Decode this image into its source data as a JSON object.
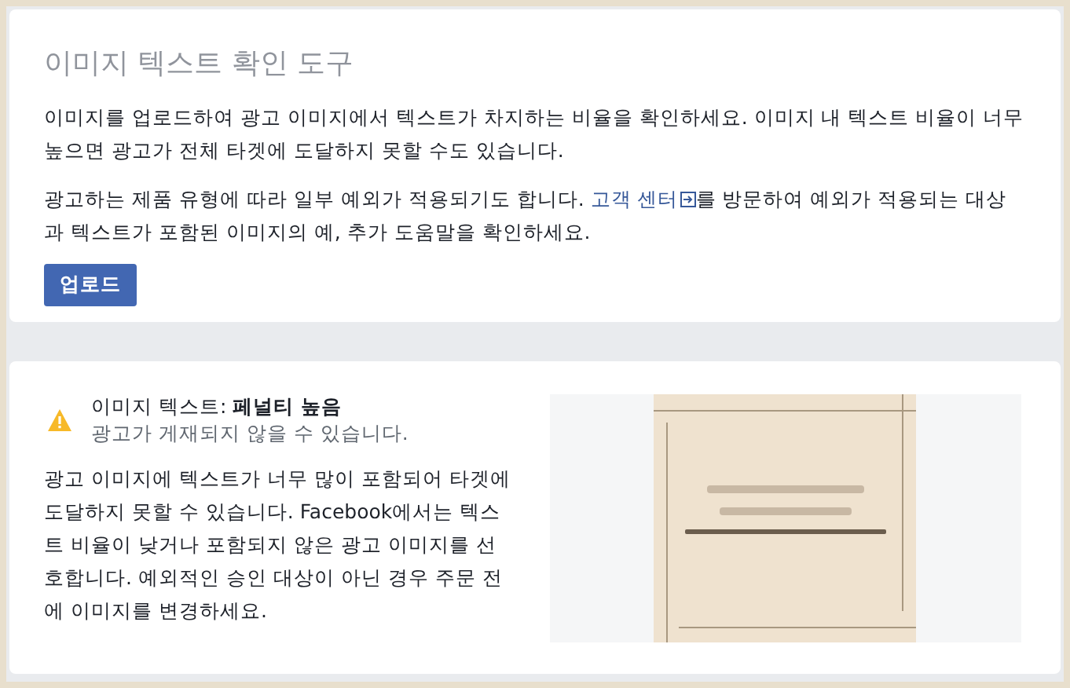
{
  "tool_card": {
    "title": "이미지 텍스트 확인 도구",
    "description": "이미지를 업로드하여 광고 이미지에서 텍스트가 차지하는 비율을 확인하세요. 이미지 내 텍스트 비율이 너무 높으면 광고가 전체 타겟에 도달하지 못할 수도 있습니다.",
    "help_text": {
      "before": "광고하는 제품 유형에 따라 일부 예외가 적용되기도 합니다. ",
      "link": "고객 센터",
      "after": "를 방문하여 예외가 적용되는 대상과 텍스트가 포함된 이미지의 예, 추가 도움말을 확인하세요."
    },
    "button": "업로드"
  },
  "result_card": {
    "rating": "이미지 텍스트: **페널티 높음**",
    "subtitle": "광고가 게재되지 않을 수 있습니다.",
    "message": "광고 이미지에 텍스트가 너무 많이 포함되어 타겟에 도달하지 못할 수 있습니다. Facebook에서는 텍스트 비율이 낮거나 포함되지 않은 광고 이미지를 선호합니다. 예외적인 승인 대상이 아닌 경우 주문 전에 이미지를 변경하세요."
  }
}
